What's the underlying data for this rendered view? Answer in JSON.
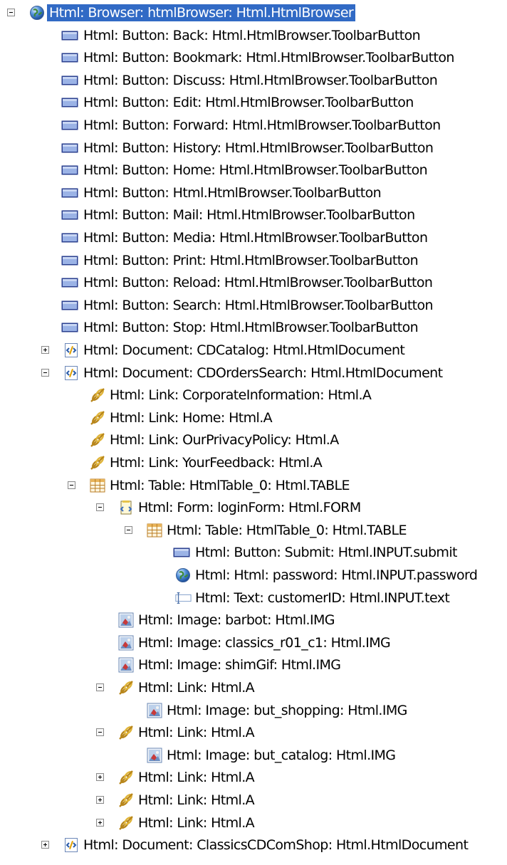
{
  "tree": {
    "rows": [
      {
        "label": "Html: Browser: htmlBrowser: Html.HtmlBrowser",
        "icon": "globe-icon",
        "expander": "collapse",
        "selected": true
      },
      {
        "label": "Html: Button: Back: Html.HtmlBrowser.ToolbarButton",
        "icon": "button-icon"
      },
      {
        "label": "Html: Button: Bookmark: Html.HtmlBrowser.ToolbarButton",
        "icon": "button-icon"
      },
      {
        "label": "Html: Button: Discuss: Html.HtmlBrowser.ToolbarButton",
        "icon": "button-icon"
      },
      {
        "label": "Html: Button: Edit: Html.HtmlBrowser.ToolbarButton",
        "icon": "button-icon"
      },
      {
        "label": "Html: Button: Forward: Html.HtmlBrowser.ToolbarButton",
        "icon": "button-icon"
      },
      {
        "label": "Html: Button: History: Html.HtmlBrowser.ToolbarButton",
        "icon": "button-icon"
      },
      {
        "label": "Html: Button: Home: Html.HtmlBrowser.ToolbarButton",
        "icon": "button-icon"
      },
      {
        "label": "Html: Button: Html.HtmlBrowser.ToolbarButton",
        "icon": "button-icon"
      },
      {
        "label": "Html: Button: Mail: Html.HtmlBrowser.ToolbarButton",
        "icon": "button-icon"
      },
      {
        "label": "Html: Button: Media: Html.HtmlBrowser.ToolbarButton",
        "icon": "button-icon"
      },
      {
        "label": "Html: Button: Print: Html.HtmlBrowser.ToolbarButton",
        "icon": "button-icon"
      },
      {
        "label": "Html: Button: Reload: Html.HtmlBrowser.ToolbarButton",
        "icon": "button-icon"
      },
      {
        "label": "Html: Button: Search: Html.HtmlBrowser.ToolbarButton",
        "icon": "button-icon"
      },
      {
        "label": "Html: Button: Stop: Html.HtmlBrowser.ToolbarButton",
        "icon": "button-icon"
      },
      {
        "label": "Html: Document: CDCatalog: Html.HtmlDocument",
        "icon": "document-icon",
        "expander": "expand"
      },
      {
        "label": "Html: Document: CDOrdersSearch: Html.HtmlDocument",
        "icon": "document-icon",
        "expander": "collapse"
      },
      {
        "label": "Html: Link: CorporateInformation: Html.A",
        "icon": "link-icon"
      },
      {
        "label": "Html: Link: Home: Html.A",
        "icon": "link-icon"
      },
      {
        "label": "Html: Link: OurPrivacyPolicy: Html.A",
        "icon": "link-icon"
      },
      {
        "label": "Html: Link: YourFeedback: Html.A",
        "icon": "link-icon"
      },
      {
        "label": "Html: Table: HtmlTable_0: Html.TABLE",
        "icon": "table-icon",
        "expander": "collapse"
      },
      {
        "label": "Html: Form: loginForm: Html.FORM",
        "icon": "form-icon",
        "expander": "collapse"
      },
      {
        "label": "Html: Table: HtmlTable_0: Html.TABLE",
        "icon": "table-icon",
        "expander": "collapse"
      },
      {
        "label": "Html: Button: Submit: Html.INPUT.submit",
        "icon": "button-icon"
      },
      {
        "label": "Html: Html: password: Html.INPUT.password",
        "icon": "globe-icon"
      },
      {
        "label": "Html: Text: customerID: Html.INPUT.text",
        "icon": "textbox-icon"
      },
      {
        "label": "Html: Image: barbot: Html.IMG",
        "icon": "image-icon"
      },
      {
        "label": "Html: Image: classics_r01_c1: Html.IMG",
        "icon": "image-icon"
      },
      {
        "label": "Html: Image: shimGif: Html.IMG",
        "icon": "image-icon"
      },
      {
        "label": "Html: Link: Html.A",
        "icon": "link-icon",
        "expander": "collapse"
      },
      {
        "label": "Html: Image: but_shopping: Html.IMG",
        "icon": "image-icon"
      },
      {
        "label": "Html: Link: Html.A",
        "icon": "link-icon",
        "expander": "collapse"
      },
      {
        "label": "Html: Image: but_catalog: Html.IMG",
        "icon": "image-icon"
      },
      {
        "label": "Html: Link: Html.A",
        "icon": "link-icon",
        "expander": "expand"
      },
      {
        "label": "Html: Link: Html.A",
        "icon": "link-icon",
        "expander": "expand"
      },
      {
        "label": "Html: Link: Html.A",
        "icon": "link-icon",
        "expander": "expand"
      },
      {
        "label": "Html: Document: ClassicsCDComShop: Html.HtmlDocument",
        "icon": "document-icon",
        "expander": "expand"
      }
    ]
  },
  "colors": {
    "selection": "#316ac5",
    "button_fill": "#9bb3e6",
    "button_border": "#2a3f8f",
    "link": "#c9a227",
    "table": "#c58a2e"
  }
}
